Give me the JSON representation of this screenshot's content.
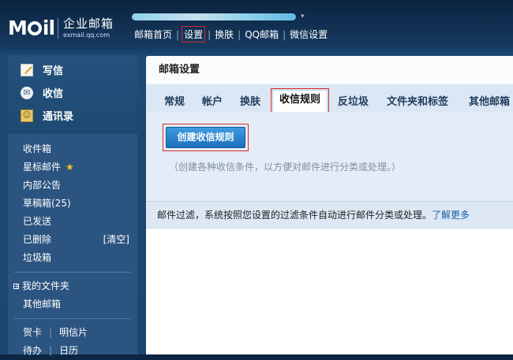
{
  "header": {
    "logo_mark": "M",
    "logo_mark_tail": "il",
    "logo_cn": "企业邮箱",
    "logo_url": "exmail.qq.com",
    "account_caret": "▾",
    "nav": [
      "邮箱首页",
      "设置",
      "换肤",
      "QQ邮箱",
      "微信设置"
    ]
  },
  "sidebar": {
    "quick": [
      {
        "label": "写信",
        "icon": "compose-icon"
      },
      {
        "label": "收信",
        "icon": "inbox-icon"
      },
      {
        "label": "通讯录",
        "icon": "contacts-icon"
      }
    ],
    "folders": [
      "收件箱",
      "星标邮件",
      "内部公告",
      "草稿箱(25)",
      "已发送",
      "已删除",
      "垃圾箱"
    ],
    "star_glyph": "★",
    "clear_label": "[清空]",
    "my_folders": "我的文件夹",
    "other_mail": "其他邮箱",
    "expander_glyph": "+",
    "tools_row1": [
      "贺卡",
      "明信片"
    ],
    "tools_row2": [
      "待办",
      "日历"
    ],
    "tools_sep": "|"
  },
  "main": {
    "title": "邮箱设置",
    "tabs": [
      "常规",
      "帐户",
      "换肤",
      "收信规则",
      "反垃圾",
      "文件夹和标签",
      "其他邮箱"
    ],
    "active_tab": "收信规则",
    "create_button": "创建收信规则",
    "hint": "（创建各种收信条件，以方便对邮件进行分类或处理。）",
    "info_text": "邮件过滤，系统按照您设置的过滤条件自动进行邮件分类或处理。",
    "info_link": "了解更多"
  },
  "colors": {
    "highlight_border": "#d42b2b",
    "button": "#1c6fbd",
    "link": "#1d5fa8"
  }
}
